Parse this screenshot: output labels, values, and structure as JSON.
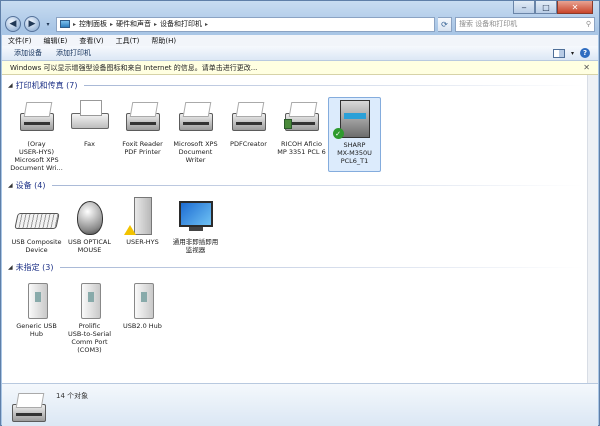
{
  "address": {
    "crumbs": [
      "控制面板",
      "硬件和声音",
      "设备和打印机"
    ],
    "search_placeholder": "搜索 设备和打印机"
  },
  "menu": [
    "文件(F)",
    "编辑(E)",
    "查看(V)",
    "工具(T)",
    "帮助(H)"
  ],
  "commands": [
    "添加设备",
    "添加打印机"
  ],
  "infobar": "Windows 可以显示增强型设备图标和来自 Internet 的信息。请单击进行更改...",
  "groups": {
    "printers": {
      "title": "打印机和传真 (7)",
      "items": [
        {
          "label": "(Oray\nUSER-HYS)\nMicrosoft XPS\nDocument Wri...",
          "icon": "printer-icon"
        },
        {
          "label": "Fax",
          "icon": "fax-icon"
        },
        {
          "label": "Foxit Reader\nPDF Printer",
          "icon": "printer-icon"
        },
        {
          "label": "Microsoft XPS\nDocument\nWriter",
          "icon": "printer-icon"
        },
        {
          "label": "PDFCreator",
          "icon": "printer-icon"
        },
        {
          "label": "RICOH Aficio\nMP 3351 PCL 6",
          "icon": "printer-icon"
        },
        {
          "label": "SHARP\nMX-M350U\nPCL6_T1",
          "icon": "copier-icon",
          "selected": true,
          "default": true
        }
      ]
    },
    "devices": {
      "title": "设备 (4)",
      "items": [
        {
          "label": "USB Composite\nDevice",
          "icon": "keyboard-icon"
        },
        {
          "label": "USB OPTICAL\nMOUSE",
          "icon": "mouse-icon"
        },
        {
          "label": "USER-HYS",
          "icon": "computer-icon",
          "warning": true
        },
        {
          "label": "通用非即插即用\n监视器",
          "icon": "monitor-icon"
        }
      ]
    },
    "unspecified": {
      "title": "未指定 (3)",
      "items": [
        {
          "label": "Generic USB\nHub",
          "icon": "usb-hub-icon"
        },
        {
          "label": "Prolific\nUSB-to-Serial\nComm Port\n(COM3)",
          "icon": "usb-hub-icon"
        },
        {
          "label": "USB2.0 Hub",
          "icon": "usb-hub-icon"
        }
      ]
    }
  },
  "details": {
    "count": "14 个对象"
  }
}
